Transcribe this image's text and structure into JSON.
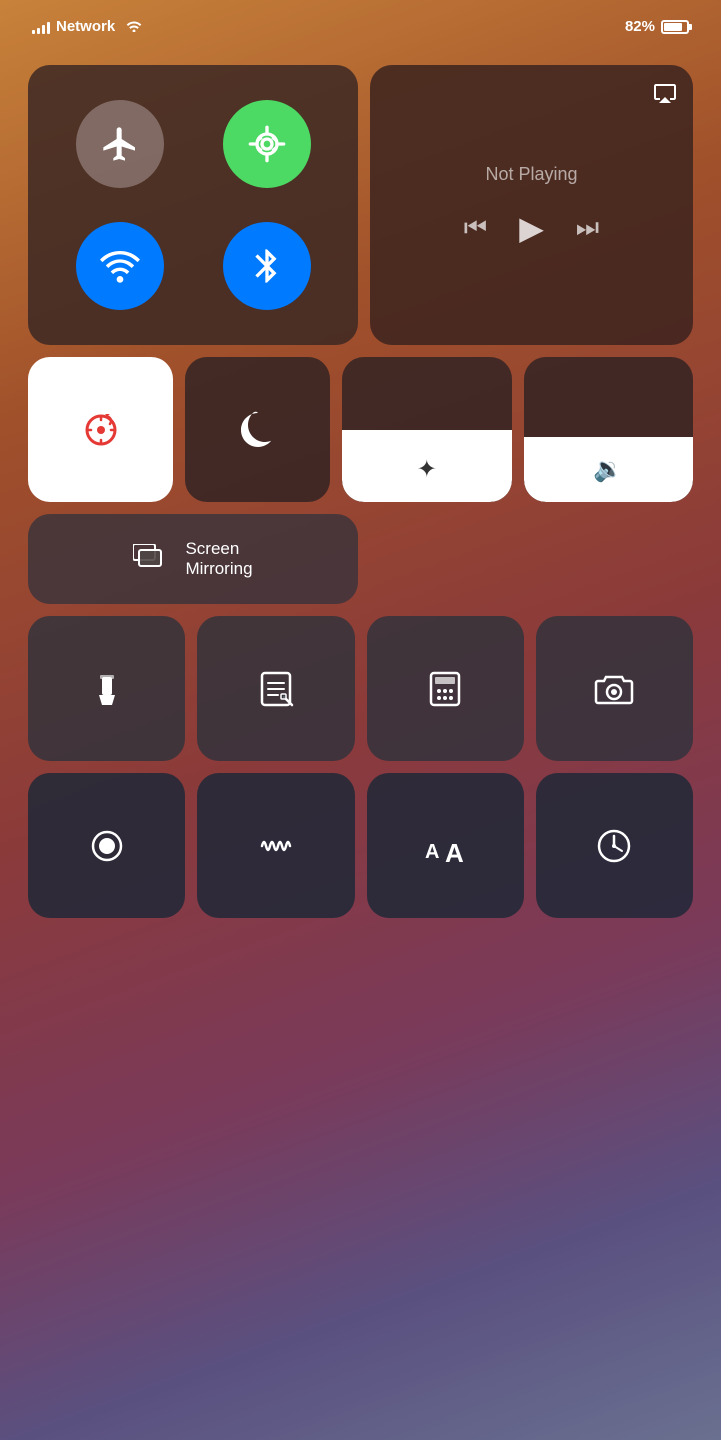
{
  "status_bar": {
    "network_name": "Network",
    "battery_percent": "82%"
  },
  "network_tile": {
    "airplane_label": "Airplane Mode",
    "cellular_label": "Cellular",
    "wifi_label": "Wi-Fi",
    "bluetooth_label": "Bluetooth"
  },
  "media_tile": {
    "not_playing": "Not Playing",
    "airplay_label": "AirPlay"
  },
  "row2": {
    "orientation_label": "Orientation Lock",
    "donotdisturb_label": "Do Not Disturb",
    "brightness_label": "Brightness",
    "volume_label": "Volume"
  },
  "screen_mirroring": {
    "label_line1": "Screen",
    "label_line2": "Mirroring"
  },
  "row3": {
    "flashlight_label": "Flashlight",
    "notes_label": "Notes",
    "calculator_label": "Calculator",
    "camera_label": "Camera"
  },
  "row4": {
    "screen_record_label": "Screen Record",
    "voice_memos_label": "Voice Memos",
    "text_size_label": "Text Size",
    "clock_label": "Clock"
  }
}
